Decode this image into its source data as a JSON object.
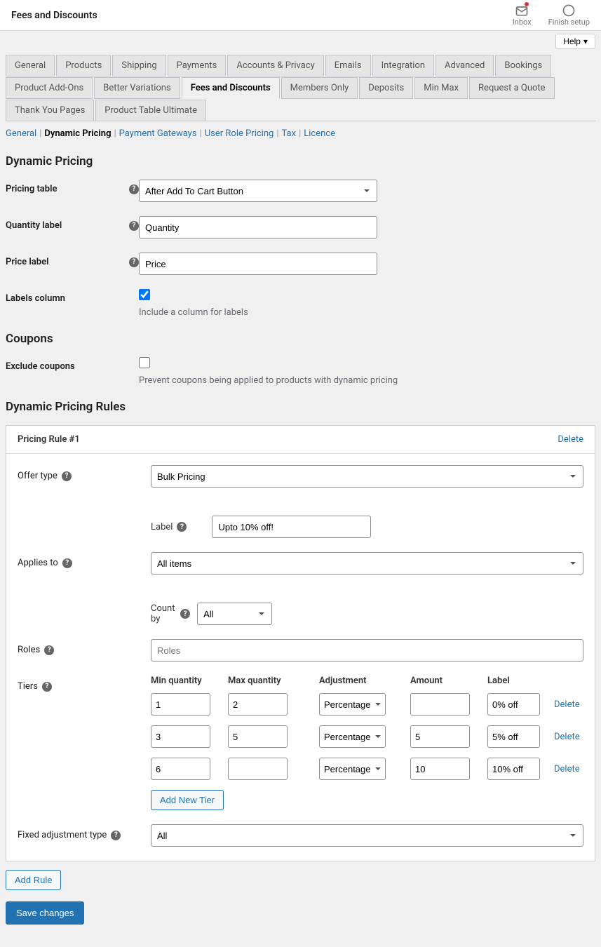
{
  "topbar": {
    "title": "Fees and Discounts",
    "inbox_label": "Inbox",
    "finish_label": "Finish setup"
  },
  "help_label": "Help",
  "tabs_row1": [
    "General",
    "Products",
    "Shipping",
    "Payments",
    "Accounts & Privacy",
    "Emails",
    "Integration",
    "Advanced",
    "Bookings",
    "Product Add-Ons"
  ],
  "tabs_row2": [
    "Better Variations",
    "Fees and Discounts",
    "Members Only",
    "Deposits",
    "Min Max",
    "Request a Quote",
    "Thank You Pages",
    "Product Table Ultimate"
  ],
  "active_tab": "Fees and Discounts",
  "subnav": {
    "items": [
      "General",
      "Dynamic Pricing",
      "Payment Gateways",
      "User Role Pricing",
      "Tax",
      "Licence"
    ],
    "current": "Dynamic Pricing"
  },
  "sections": {
    "dynamic_pricing": "Dynamic Pricing",
    "coupons": "Coupons",
    "rules": "Dynamic Pricing Rules"
  },
  "fields": {
    "pricing_table": {
      "label": "Pricing table",
      "value": "After Add To Cart Button"
    },
    "quantity_label": {
      "label": "Quantity label",
      "value": "Quantity"
    },
    "price_label": {
      "label": "Price label",
      "value": "Price"
    },
    "labels_column": {
      "label": "Labels column",
      "checked": true,
      "help": "Include a column for labels"
    },
    "exclude_coupons": {
      "label": "Exclude coupons",
      "checked": false,
      "help": "Prevent coupons being applied to products with dynamic pricing"
    }
  },
  "rule": {
    "title": "Pricing Rule #1",
    "delete": "Delete",
    "offer_type": {
      "label": "Offer type",
      "value": "Bulk Pricing"
    },
    "label_field": {
      "label": "Label",
      "value": "Upto 10% off!"
    },
    "applies_to": {
      "label": "Applies to",
      "value": "All items"
    },
    "count_by": {
      "label": "Count by",
      "value": "All"
    },
    "roles": {
      "label": "Roles",
      "placeholder": "Roles"
    },
    "tiers": {
      "label": "Tiers",
      "headers": {
        "min": "Min quantity",
        "max": "Max quantity",
        "adj": "Adjustment",
        "amt": "Amount",
        "lbl": "Label"
      },
      "rows": [
        {
          "min": "1",
          "max": "2",
          "adj": "Percentage Discount",
          "amt": "",
          "lbl": "0% off"
        },
        {
          "min": "3",
          "max": "5",
          "adj": "Percentage Discount",
          "amt": "5",
          "lbl": "5% off"
        },
        {
          "min": "6",
          "max": "",
          "adj": "Percentage Discount",
          "amt": "10",
          "lbl": "10% off"
        }
      ],
      "delete": "Delete",
      "add_tier": "Add New Tier"
    },
    "fixed_adj": {
      "label": "Fixed adjustment type",
      "value": "All"
    }
  },
  "add_rule": "Add Rule",
  "save": "Save changes"
}
